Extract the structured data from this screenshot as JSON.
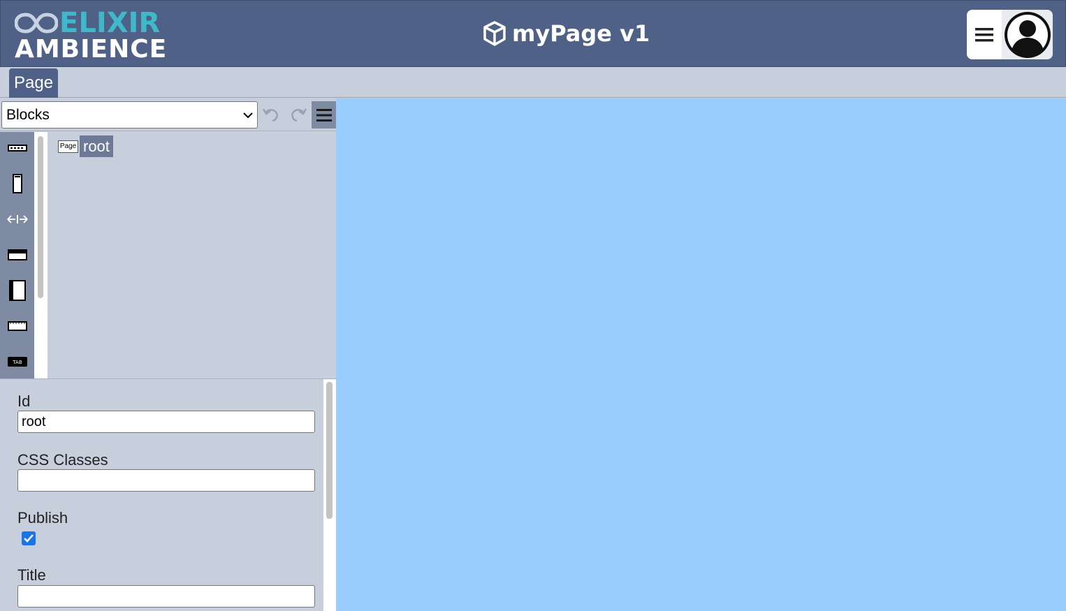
{
  "header": {
    "logo_top": "ELIXIR",
    "logo_bottom": "AMBIENCE",
    "app_title": "myPage v1",
    "colors": {
      "header_bg": "#4f6186",
      "logo_accent": "#3fb8c9"
    }
  },
  "tabs": [
    {
      "label": "Page"
    }
  ],
  "toolbar": {
    "select_value": "Blocks",
    "undo_icon": "undo-icon",
    "redo_icon": "redo-icon",
    "menu_icon": "hamburger-icon"
  },
  "palette": [
    "row-block-icon",
    "column-block-icon",
    "spacer-block-icon",
    "header-block-icon",
    "sidebar-block-icon",
    "card-block-icon",
    "tab-block-icon"
  ],
  "palette_labels": {
    "tab": "TAB"
  },
  "tree": {
    "root": {
      "type": "Page",
      "label": "root"
    }
  },
  "properties": {
    "id_label": "Id",
    "id_value": "root",
    "css_label": "CSS Classes",
    "css_value": "",
    "publish_label": "Publish",
    "publish_checked": true,
    "title_label": "Title",
    "title_value": ""
  },
  "canvas": {
    "background": "#99ccff"
  }
}
